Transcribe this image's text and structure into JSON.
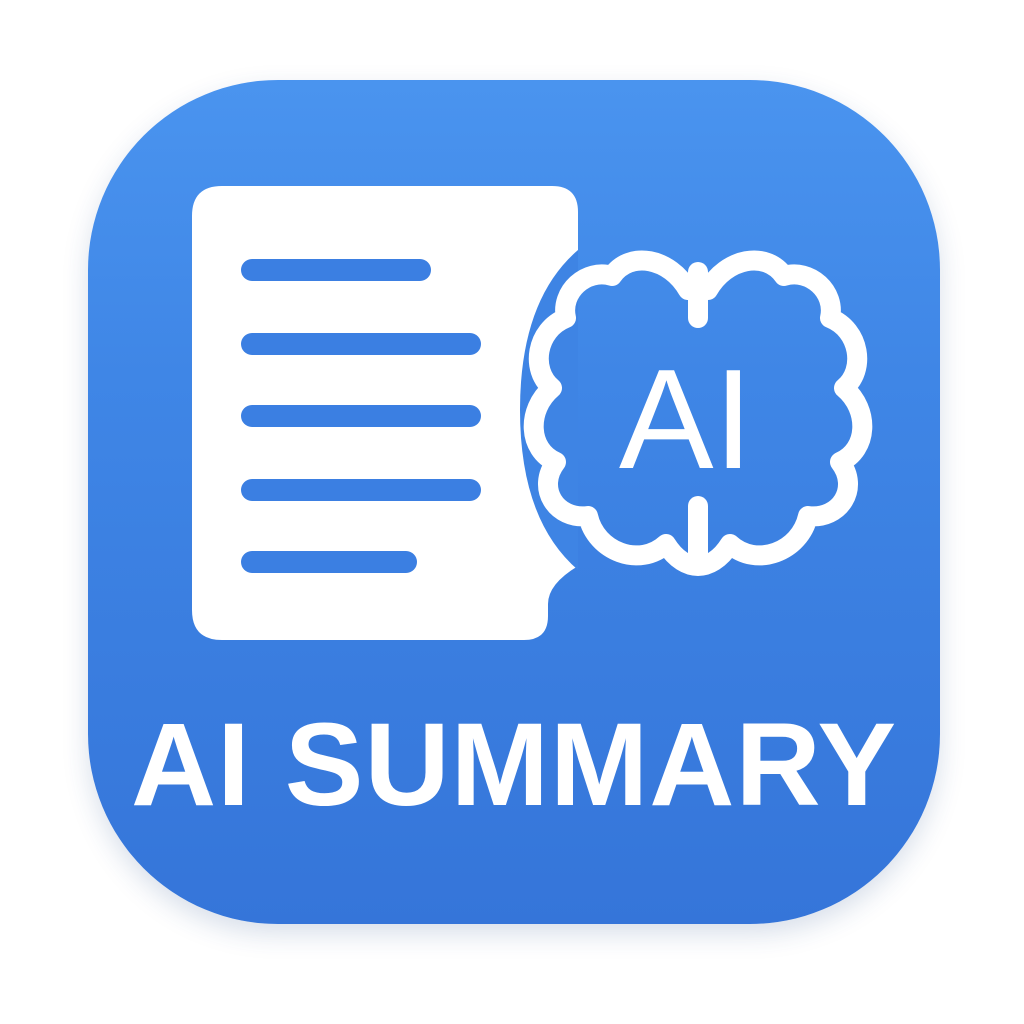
{
  "app_icon": {
    "title": "AI SUMMARY",
    "brain_label": "AI",
    "background_color": "#3f86e6",
    "foreground_color": "#ffffff",
    "icons": [
      "document-icon",
      "brain-icon"
    ]
  }
}
